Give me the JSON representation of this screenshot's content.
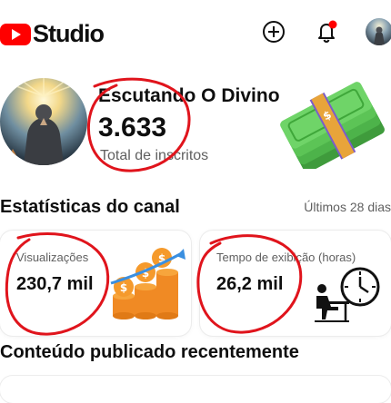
{
  "app": {
    "logo_text": "Studio",
    "brand_color": "#ff0000"
  },
  "top_actions": [
    {
      "name": "create",
      "icon": "plus-circle-icon"
    },
    {
      "name": "notifications",
      "icon": "bell-icon",
      "has_badge": true
    },
    {
      "name": "account",
      "icon": "avatar"
    }
  ],
  "channel": {
    "name": "Escutando O Divino",
    "subscribers": "3.633",
    "subscribers_label": "Total de inscritos"
  },
  "stats": {
    "title": "Estatísticas do canal",
    "period": "Últimos 28 dias",
    "cards": [
      {
        "label": "Visualizações",
        "value": "230,7 mil"
      },
      {
        "label": "Tempo de exibição (horas)",
        "value": "26,2 mil"
      }
    ]
  },
  "recent": {
    "title": "Conteúdo publicado recentemente"
  },
  "annotation_color": "#e0141c"
}
